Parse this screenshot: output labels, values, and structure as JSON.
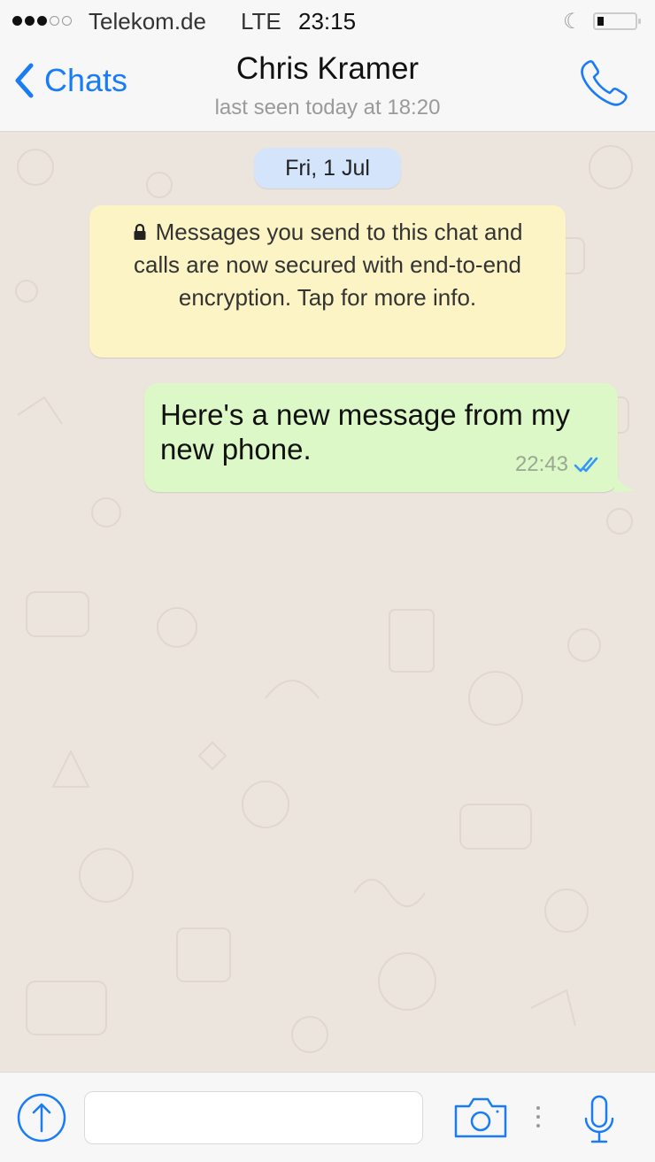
{
  "status_bar": {
    "signal_strength": "3 of 5",
    "carrier": "Telekom.de",
    "network": "LTE",
    "time": "23:15",
    "do_not_disturb_icon": "moon-icon",
    "battery_icon": "battery-icon",
    "battery_level": 0.15
  },
  "header": {
    "back_label": "Chats",
    "back_icon": "chevron-left-icon",
    "contact_name": "Chris Kramer",
    "last_seen": "last seen today at 18:20",
    "call_icon": "phone-icon"
  },
  "chat": {
    "date_label": "Fri, 1 Jul",
    "encryption_notice": {
      "icon": "lock-icon",
      "text": "Messages you send to this chat and calls are now secured with end-to-end encryption. Tap for more info."
    },
    "messages": [
      {
        "direction": "outgoing",
        "text": "Here's a new message from my new phone.",
        "time": "22:43",
        "status": "delivered",
        "status_icon": "double-check-icon"
      }
    ]
  },
  "input_bar": {
    "attach_icon": "upload-arrow-icon",
    "message_value": "",
    "message_placeholder": "",
    "camera_icon": "camera-icon",
    "mic_icon": "microphone-icon"
  },
  "colors": {
    "accent": "#1a7cf5",
    "outgoing_bubble": "#dcf8c6",
    "notice_bubble": "#fdf4c5",
    "date_pill": "#d4e5fb",
    "chat_background": "#ece5dd",
    "read_tick": "#3497f9"
  }
}
